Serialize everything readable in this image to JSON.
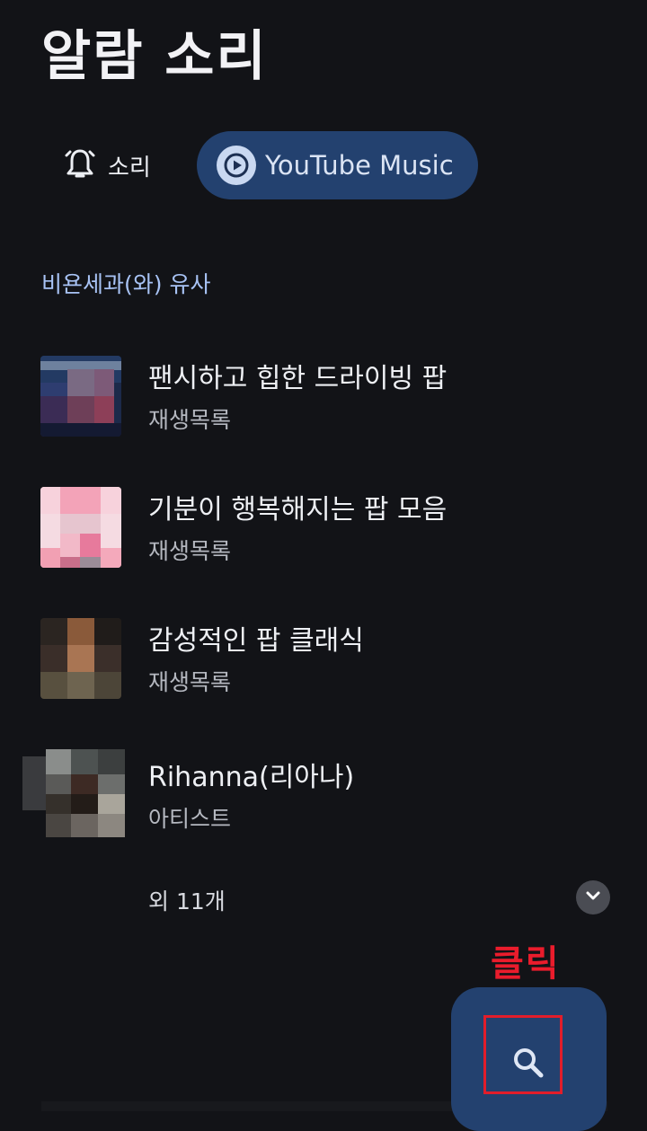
{
  "page": {
    "title": "알람 소리"
  },
  "tabs": [
    {
      "label": "소리",
      "icon": "bell-icon",
      "selected": false
    },
    {
      "label": "YouTube Music",
      "icon": "play-circle-icon",
      "selected": true
    }
  ],
  "section": {
    "header": "비욘세과(와) 유사"
  },
  "items": [
    {
      "title": "팬시하고 힙한 드라이빙 팝",
      "subtitle": "재생목록"
    },
    {
      "title": "기분이 행복해지는 팝 모음",
      "subtitle": "재생목록"
    },
    {
      "title": "감성적인 팝 클래식",
      "subtitle": "재생목록"
    },
    {
      "title": "Rihanna(리아나)",
      "subtitle": "아티스트"
    }
  ],
  "more": {
    "label": "외 11개",
    "icon": "chevron-down-icon"
  },
  "annotation": {
    "label": "클릭",
    "color": "#ea1c2c"
  },
  "fab": {
    "icon": "search-icon",
    "background": "#23416f"
  },
  "colors": {
    "background": "#121317",
    "accent_text": "#a8c3f5",
    "selected_chip": "#23416f"
  }
}
